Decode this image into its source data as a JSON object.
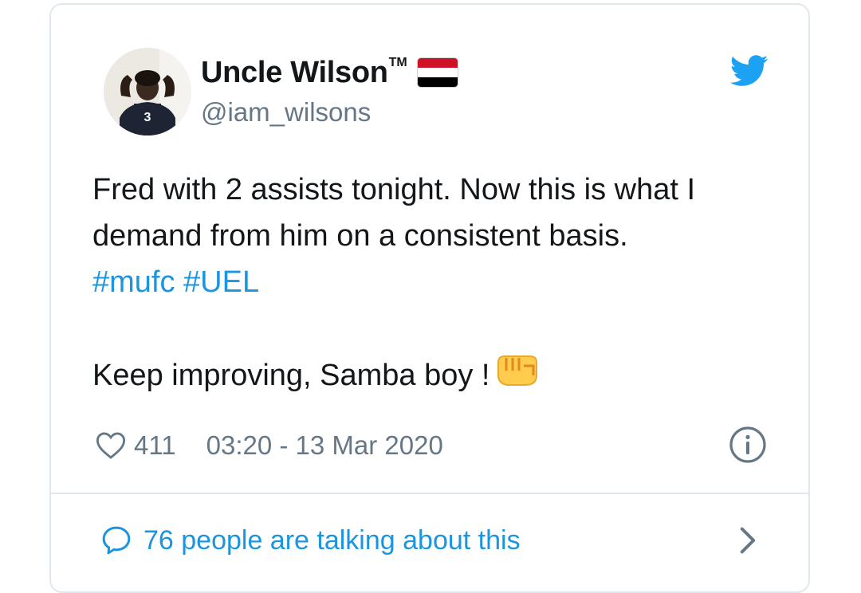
{
  "author": {
    "name": "Uncle Wilson",
    "trademark": "TM",
    "handle": "@iam_wilsons",
    "flag_icon": "yemen-flag-icon",
    "flag_colors": [
      "#ce1126",
      "#ffffff",
      "#000000"
    ]
  },
  "brand": {
    "icon": "twitter-bird-icon",
    "color": "#1da1f2"
  },
  "tweet": {
    "line1": "Fred with 2 assists tonight. Now this is what I",
    "line2": "demand from him on a consistent basis.",
    "hashtag1": "#mufc",
    "hashtag2": "#UEL",
    "line4": "Keep improving, Samba boy !",
    "emoji": "oncoming-fist-emoji"
  },
  "footer": {
    "likes": "411",
    "timestamp": "03:20 - 13 Mar 2020",
    "talking": "76 people are talking about this"
  },
  "colors": {
    "text": "#14171a",
    "secondary": "#657786",
    "link": "#1b95e0",
    "border": "#e1e8ed"
  }
}
